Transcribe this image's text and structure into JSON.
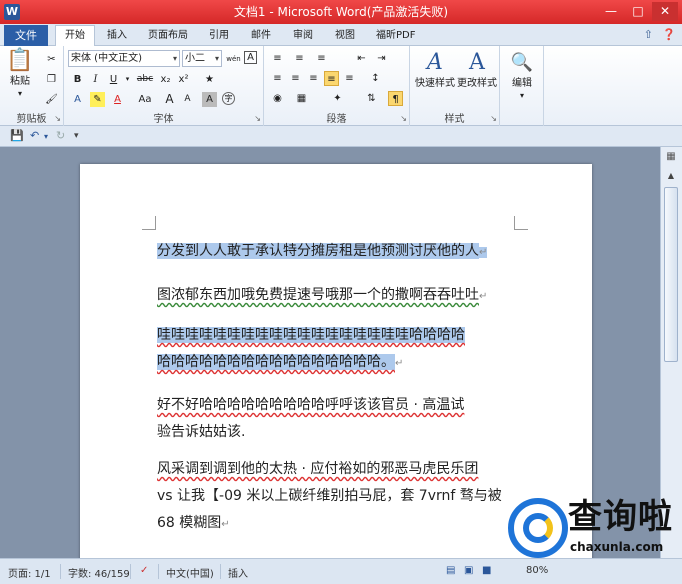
{
  "window": {
    "title": "文档1 - Microsoft Word(产品激活失败)",
    "app_icon_letter": "W"
  },
  "tabs": {
    "file": "文件",
    "items": [
      "开始",
      "插入",
      "页面布局",
      "引用",
      "邮件",
      "审阅",
      "视图",
      "福昕PDF"
    ],
    "active": "开始"
  },
  "ribbon": {
    "clipboard": {
      "label": "剪贴板",
      "paste": "粘贴"
    },
    "font": {
      "label": "字体",
      "font_name": "宋体 (中文正文)",
      "font_size": "小二",
      "bold": "B",
      "italic": "I",
      "underline": "U",
      "strike": "abc",
      "subscript": "x₂",
      "superscript": "x²",
      "grow": "A",
      "shrink": "A",
      "clear": "A",
      "phonetic": "wén",
      "border_char": "A",
      "char_shade": "A"
    },
    "paragraph": {
      "label": "段落"
    },
    "styles": {
      "label": "样式",
      "quick_styles": "快速样式",
      "change_styles": "更改样式"
    },
    "editing": {
      "label": "编辑"
    }
  },
  "document": {
    "paragraphs": [
      {
        "lines": [
          "分发到人人敢于承认特分摊房租是他预测讨厌他的人"
        ],
        "selected": true
      },
      {
        "lines": [
          "图浓郁东西加哦免费提速号哦那一个的撒啊吞吞吐吐"
        ],
        "selected": false
      },
      {
        "lines": [
          "哇哇哇哇哇哇哇哇哇哇哇哇哇哇哇哇哇哇哈哈哈哈",
          "哈哈哈哈哈哈哈哈哈哈哈哈哈哈哈哈。"
        ],
        "selected": "partial"
      },
      {
        "lines": [
          "好不好哈哈哈哈哈哈哈哈哈呼呼该该官员 · 高温试",
          "验告诉姑姑该."
        ],
        "selected": false
      },
      {
        "lines": [
          "风采调到调到他的太热 · 应付裕如的邪恶马虎民乐团",
          "vs 让我【-09 米以上碳纤维别拍马屁，套 7vrnf 骛与被",
          "68 模糊图"
        ],
        "selected": false
      }
    ]
  },
  "status": {
    "page": "页面: 1/1",
    "words": "字数: 46/159",
    "language": "中文(中国)",
    "mode": "插入",
    "zoom": "80%"
  },
  "watermark": {
    "name": "查询啦",
    "url": "chaxunla.com"
  }
}
